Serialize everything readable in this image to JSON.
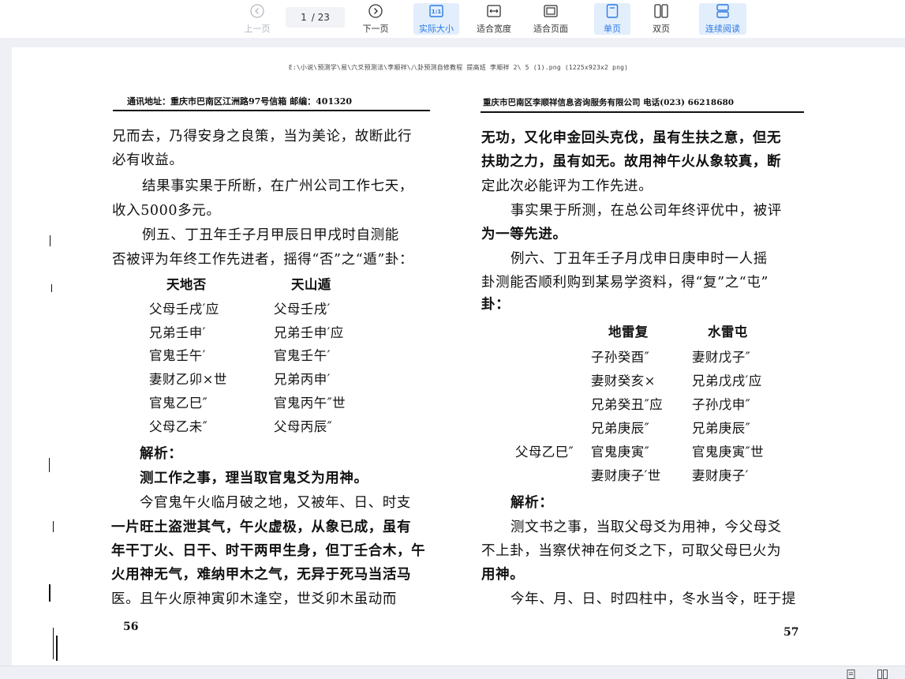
{
  "toolbar": {
    "prev_label": "上一页",
    "next_label": "下一页",
    "page_current": "1",
    "page_total": "/ 23",
    "actual_size_label": "实际大小",
    "fit_width_label": "适合宽度",
    "fit_page_label": "适合页面",
    "single_page_label": "单页",
    "double_page_label": "双页",
    "continuous_label": "连续阅读",
    "accent_color": "#2b7be4"
  },
  "document": {
    "file_path": "E:\\小说\\预测学\\易\\六爻预测法\\李顺祥\\八卦预测自修教程 提高班 李顺祥  2\\ 5 (1).png (1225x923x2 png)",
    "left_page": {
      "header": "通讯地址：重庆市巴南区江洲路97号信箱 邮编：401320",
      "lines": [
        "兄而去，乃得安身之良策，当为美论，故断此行",
        "必有收益。",
        "结果事实果于所断，在广州公司工作七天，",
        "收入5000多元。",
        "例五、丁丑年壬子月甲辰日甲戌时自测能",
        "否被评为年终工作先进者，摇得“否”之“遁”卦："
      ],
      "gua_title_left": "天地否",
      "gua_title_right": "天山遁",
      "gua_rows": [
        [
          "父母壬戌′应",
          "父母壬戌′"
        ],
        [
          "兄弟壬申′",
          "兄弟壬申′应"
        ],
        [
          "官鬼壬午′",
          "官鬼壬午′"
        ],
        [
          "妻财乙卯×世",
          "兄弟丙申′"
        ],
        [
          "官鬼乙巳″",
          "官鬼丙午″世"
        ],
        [
          "父母乙未″",
          "父母丙辰″"
        ]
      ],
      "analysis_label": "解析：",
      "lines_after": [
        "测工作之事，理当取官鬼爻为用神。",
        "今官鬼午火临月破之地，又被年、日、时支",
        "一片旺土盗泄其气，午火虚极，从象已成，虽有",
        "年干丁火、日干、时干两甲生身，但丁壬合木，午",
        "火用神无气，难纳甲木之气，无异于死马当活马",
        "医。且午火原神寅卯木逢空，世爻卯木虽动而"
      ],
      "page_number": "56"
    },
    "right_page": {
      "header": "重庆市巴南区李顺祥信息咨询服务有限公司 电话(023) 66218680",
      "lines": [
        "无功，又化申金回头克伐，虽有生扶之意，但无",
        "扶助之力，虽有如无。故用神午火从象较真，断",
        "定此次必能评为工作先进。",
        "事实果于所测，在总公司年终评优中，被评",
        "为一等先进。",
        "例六、丁丑年壬子月戊申日庚申时一人摇",
        "卦测能否顺利购到某易学资料，得“复”之“屯”",
        "卦："
      ],
      "gua_title_left": "地雷复",
      "gua_title_right": "水雷屯",
      "gua_rows": [
        [
          "",
          "子孙癸酉″",
          "妻财戊子″"
        ],
        [
          "",
          "妻财癸亥×",
          "兄弟戊戌′应"
        ],
        [
          "",
          "兄弟癸丑″应",
          "子孙戊申″"
        ],
        [
          "",
          "兄弟庚辰″",
          "兄弟庚辰″"
        ],
        [
          "父母乙巳″",
          "官鬼庚寅″",
          "官鬼庚寅″世"
        ],
        [
          "",
          "妻财庚子′世",
          "妻财庚子′"
        ]
      ],
      "analysis_label": "解析：",
      "lines_after": [
        "测文书之事，当取父母爻为用神，今父母爻",
        "不上卦，当察伏神在何爻之下，可取父母巳火为",
        "用神。",
        "今年、月、日、时四柱中，冬水当令，旺于提"
      ],
      "page_number": "57"
    }
  }
}
